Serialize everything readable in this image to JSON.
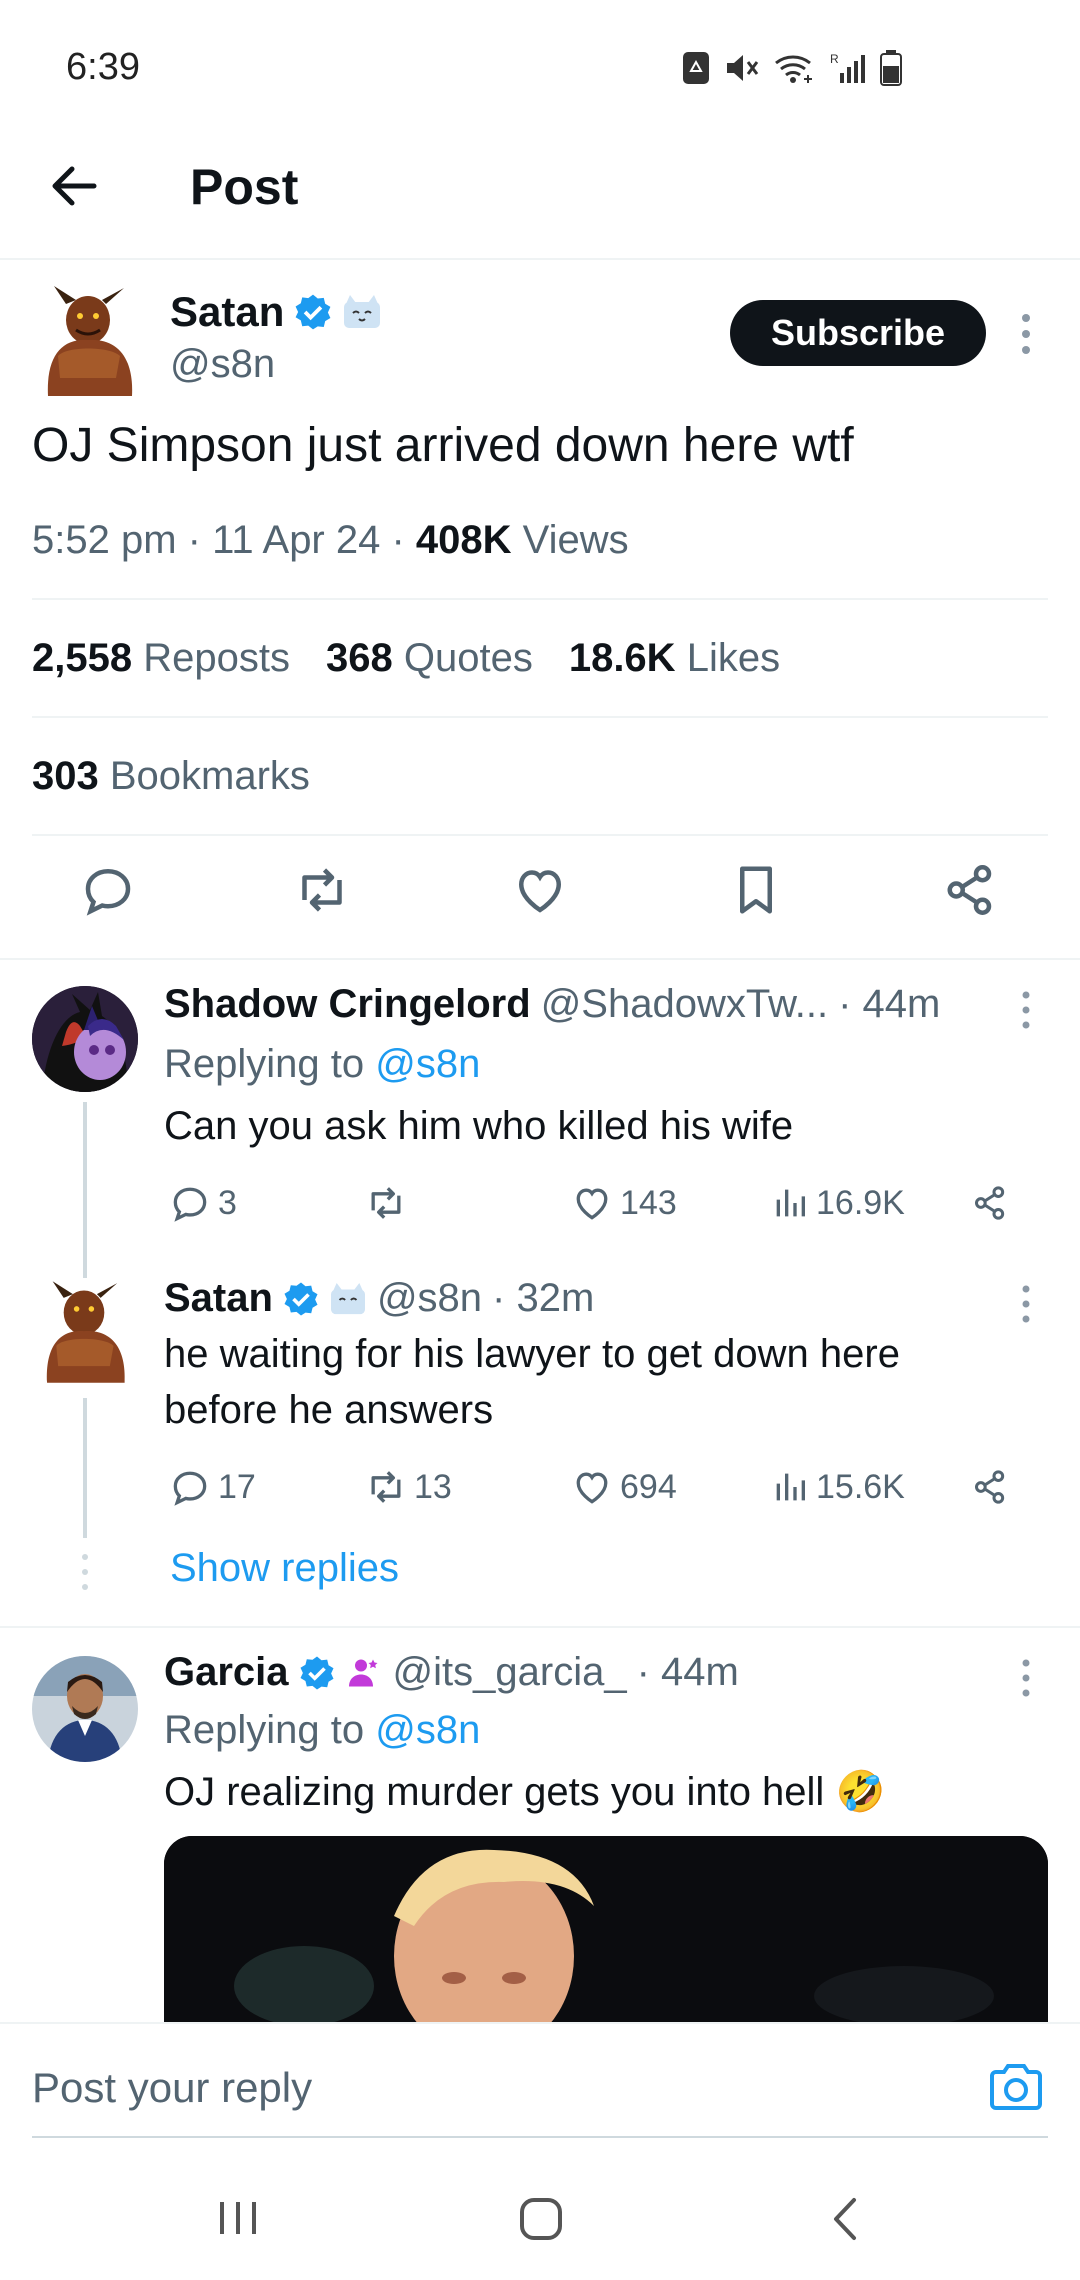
{
  "status_bar": {
    "time": "6:39"
  },
  "header": {
    "title": "Post"
  },
  "post": {
    "author_name": "Satan",
    "author_handle": "@s8n",
    "subscribe_label": "Subscribe",
    "text": "OJ Simpson just arrived down here wtf",
    "time": "5:52 pm · 11 Apr 24 · ",
    "views_count": "408K",
    "views_label": " Views",
    "reposts_count": "2,558",
    "reposts_label": "Reposts",
    "quotes_count": "368",
    "quotes_label": "Quotes",
    "likes_count": "18.6K",
    "likes_label": "Likes",
    "bookmarks_count": "303",
    "bookmarks_label": "Bookmarks"
  },
  "replies": [
    {
      "name": "Shadow Cringelord",
      "handle": "@ShadowxTw...",
      "time": "· 44m",
      "replying_label": "Replying to",
      "replying_to": "@s8n",
      "text": "Can you ask him who killed his wife",
      "replies": "3",
      "reposts": "",
      "likes": "143",
      "views": "16.9K"
    },
    {
      "name": "Satan",
      "handle": "@s8n",
      "time": "· 32m",
      "text": "he waiting for his lawyer to get down here before he answers",
      "replies": "17",
      "reposts": "13",
      "likes": "694",
      "views": "15.6K"
    },
    {
      "name": "Garcia",
      "handle": "@its_garcia_",
      "time": "· 44m",
      "replying_label": "Replying to",
      "replying_to": "@s8n",
      "text": "OJ realizing murder gets you into hell",
      "emoji": "🤣"
    }
  ],
  "show_replies_label": "Show replies",
  "reply_bar": {
    "placeholder": "Post your reply"
  },
  "colors": {
    "accent": "#1d9bf0",
    "text": "#0f1419",
    "muted": "#536471",
    "divider": "#eff3f4"
  }
}
